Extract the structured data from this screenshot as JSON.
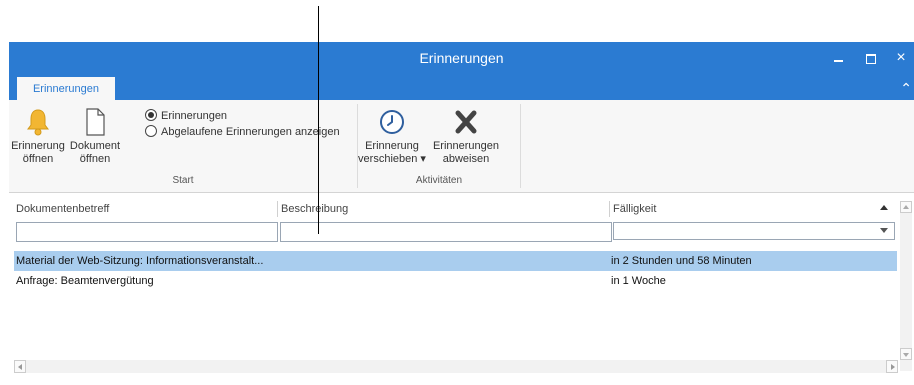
{
  "window": {
    "title": "Erinnerungen",
    "titlebar_color": "#2b7bd2",
    "controls": [
      "minimize-icon",
      "maximize-icon",
      "close-icon"
    ],
    "close_glyph": "×"
  },
  "ribbon": {
    "active_tab": "Erinnerungen",
    "collapse_glyph": "⌃",
    "groups": {
      "start": {
        "label": "Start",
        "open_reminder": {
          "line1": "Erinnerung",
          "line2": "öffnen",
          "icon": "bell-icon"
        },
        "open_document": {
          "line1": "Dokument",
          "line2": "öffnen",
          "icon": "document-icon"
        },
        "radio_reminders": {
          "label": "Erinnerungen",
          "checked": true
        },
        "radio_expired": {
          "label": "Abgelaufene Erinnerungen anzeigen",
          "checked": false
        }
      },
      "activities": {
        "label": "Aktivitäten",
        "snooze": {
          "line1": "Erinnerung",
          "line2": "verschieben ▾",
          "icon": "clock-icon"
        },
        "dismiss": {
          "line1": "Erinnerungen",
          "line2": "abweisen",
          "icon": "x-icon"
        }
      }
    }
  },
  "grid": {
    "columns": [
      "Dokumentenbetreff",
      "Beschreibung",
      "Fälligkeit"
    ],
    "sort_column": "Fälligkeit",
    "sort_direction": "ascending",
    "filter_values": [
      "",
      "",
      ""
    ],
    "rows": [
      {
        "subject": "Material der Web-Sitzung: Informationsveranstalt...",
        "description": "",
        "due": "in 2 Stunden und 58 Minuten",
        "selected": true
      },
      {
        "subject": "Anfrage: Beamtenvergütung",
        "description": "",
        "due": "in 1 Woche",
        "selected": false
      }
    ],
    "selection_color": "#a9cdee"
  }
}
